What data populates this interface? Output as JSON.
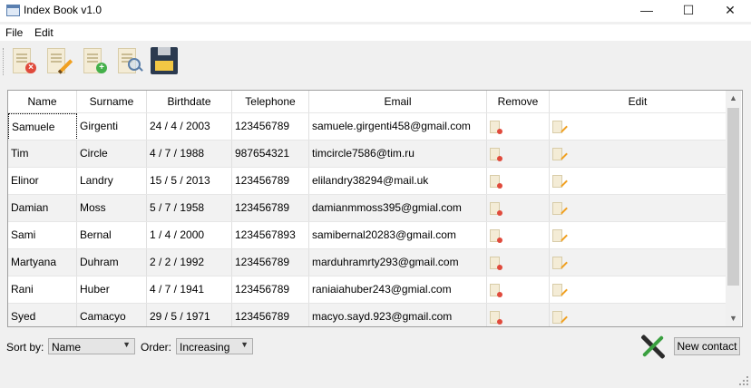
{
  "window": {
    "title": "Index Book v1.0",
    "min_glyph": "—",
    "max_glyph": "☐",
    "close_glyph": "✕"
  },
  "menu": {
    "items": [
      "File",
      "Edit"
    ]
  },
  "toolbar": {
    "buttons": [
      "remove-contact",
      "edit-contact",
      "add-contact",
      "search-contact",
      "save"
    ]
  },
  "table": {
    "columns": [
      "Name",
      "Surname",
      "Birthdate",
      "Telephone",
      "Email",
      "Remove",
      "Edit"
    ],
    "rows": [
      {
        "name": "Samuele",
        "surname": "Girgenti",
        "birthdate": "24 / 4 / 2003",
        "telephone": "123456789",
        "email": "samuele.girgenti458@gmail.com"
      },
      {
        "name": "Tim",
        "surname": "Circle",
        "birthdate": "4 / 7 / 1988",
        "telephone": "987654321",
        "email": "timcircle7586@tim.ru"
      },
      {
        "name": "Elinor",
        "surname": "Landry",
        "birthdate": "15 / 5 / 2013",
        "telephone": "123456789",
        "email": "elilandry38294@mail.uk"
      },
      {
        "name": "Damian",
        "surname": "Moss",
        "birthdate": "5 / 7 / 1958",
        "telephone": "123456789",
        "email": "damianmmoss395@gmial.com"
      },
      {
        "name": "Sami",
        "surname": "Bernal",
        "birthdate": "1 / 4 / 2000",
        "telephone": "1234567893",
        "email": "samibernal20283@gmail.com"
      },
      {
        "name": "Martyana",
        "surname": "Duhram",
        "birthdate": "2 / 2 / 1992",
        "telephone": "123456789",
        "email": "marduhramrty293@gmail.com"
      },
      {
        "name": "Rani",
        "surname": "Huber",
        "birthdate": "4 / 7 / 1941",
        "telephone": "123456789",
        "email": "raniaiahuber243@gmial.com"
      },
      {
        "name": "Syed",
        "surname": "Camacyo",
        "birthdate": "29 / 5 / 1971",
        "telephone": "123456789",
        "email": "macyo.sayd.923@gmail.com"
      }
    ]
  },
  "controls": {
    "sort_label": "Sort by:",
    "sort_value": "Name",
    "order_label": "Order:",
    "order_value": "Increasing",
    "new_contact_label": "New contact"
  },
  "colors": {
    "badge_red": "#e04a3c",
    "badge_green": "#44b04a",
    "floppy_body": "#2b3a4f",
    "floppy_label": "#f2c744"
  }
}
